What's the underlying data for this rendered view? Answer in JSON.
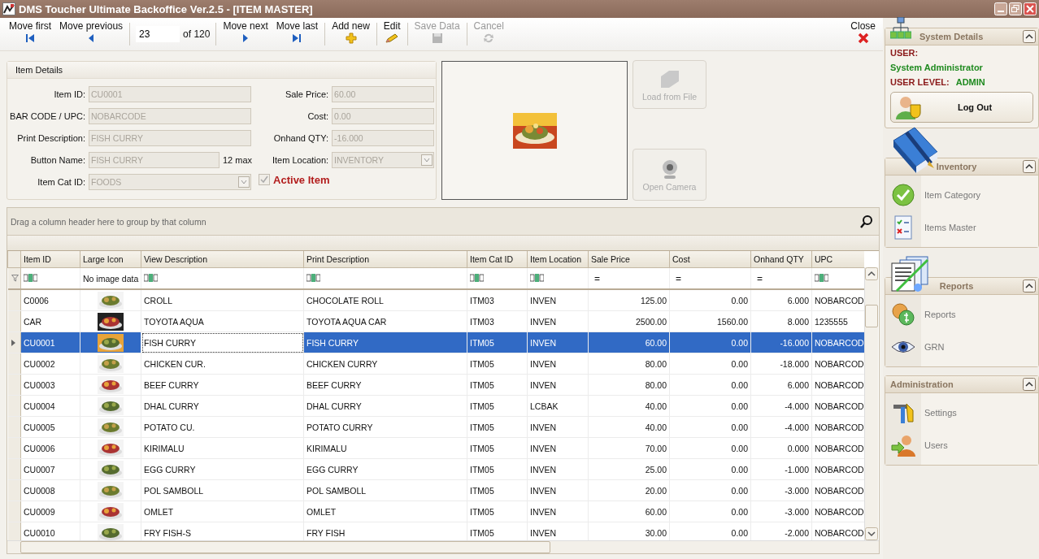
{
  "window": {
    "title": "DMS Toucher Ultimate Backoffice Ver.2.5 - [ITEM MASTER]"
  },
  "toolbar": {
    "nav": [
      {
        "label": "Move first",
        "kind": "first",
        "disabled": false
      },
      {
        "label": "Move previous",
        "kind": "previous",
        "disabled": false
      }
    ],
    "position": {
      "value": "23",
      "total": "of 120"
    },
    "actions": [
      {
        "label": "Move next",
        "kind": "next",
        "disabled": false
      },
      {
        "label": "Move last",
        "kind": "last",
        "disabled": false
      },
      {
        "label": "Add new",
        "kind": "add",
        "disabled": false
      },
      {
        "label": "Edit",
        "kind": "edit",
        "disabled": false
      },
      {
        "label": "Save Data",
        "kind": "save",
        "disabled": true
      },
      {
        "label": "Cancel",
        "kind": "cancel",
        "disabled": true
      }
    ],
    "close": {
      "label": "Close"
    }
  },
  "item_details": {
    "title": "Item Details",
    "left_fields": [
      {
        "label": "Item ID:",
        "value": "CU0001",
        "kind": "text",
        "disabled": true
      },
      {
        "label": "BAR CODE / UPC:",
        "value": "NOBARCODE",
        "kind": "text",
        "disabled": true
      },
      {
        "label": "Print Description:",
        "value": "FISH CURRY",
        "kind": "text",
        "disabled": true
      },
      {
        "label": "Button Name:",
        "value": "FISH CURRY",
        "kind": "text",
        "disabled": true,
        "note": "12 max"
      },
      {
        "label": "Item Cat ID:",
        "value": "FOODS",
        "kind": "dropdown",
        "disabled": true
      }
    ],
    "right_fields": [
      {
        "label": "Sale Price:",
        "value": "60.00",
        "kind": "text",
        "disabled": true
      },
      {
        "label": "Cost:",
        "value": "0.00",
        "kind": "text",
        "disabled": true
      },
      {
        "label": "Onhand QTY:",
        "value": "-16.000",
        "kind": "text",
        "disabled": true
      },
      {
        "label": "Item Location:",
        "value": "INVENTORY",
        "kind": "dropdown",
        "disabled": true
      }
    ],
    "active": {
      "label": "Active Item",
      "checked": true,
      "disabled": true
    }
  },
  "image_buttons": [
    {
      "label": "Load from File",
      "kind": "folder",
      "disabled": true
    },
    {
      "label": "Open Camera",
      "kind": "camera",
      "disabled": true
    }
  ],
  "grid": {
    "group_hint": "Drag a column header here to group by that column",
    "columns": [
      {
        "label": "Item ID",
        "kind": "text",
        "focused": false
      },
      {
        "label": "Large Icon",
        "kind": "icon",
        "focused": false
      },
      {
        "label": "View Description",
        "kind": "text",
        "focused": true
      },
      {
        "label": "Print Description",
        "kind": "text",
        "focused": false
      },
      {
        "label": "Item Cat ID",
        "kind": "text",
        "focused": false
      },
      {
        "label": "Item Location",
        "kind": "text",
        "focused": false
      },
      {
        "label": "Sale Price",
        "kind": "number",
        "focused": false
      },
      {
        "label": "Cost",
        "kind": "number",
        "focused": false
      },
      {
        "label": "Onhand QTY",
        "kind": "number",
        "focused": false
      },
      {
        "label": "UPC",
        "kind": "text",
        "focused": false
      }
    ],
    "filters": [
      {
        "kind": "abc"
      },
      {
        "kind": "label",
        "text": "No image data"
      },
      {
        "kind": "abc"
      },
      {
        "kind": "abc"
      },
      {
        "kind": "abc"
      },
      {
        "kind": "abc"
      },
      {
        "kind": "equals",
        "text": "="
      },
      {
        "kind": "equals",
        "text": "="
      },
      {
        "kind": "equals",
        "text": "="
      },
      {
        "kind": "abc"
      }
    ],
    "rows": [
      {
        "selected": false,
        "cells": [
          "C0006",
          "",
          "CROLL",
          "CHOCOLATE ROLL",
          "ITM03",
          "INVEN",
          "125.00",
          "0.00",
          "6.000",
          "NOBARCOD"
        ]
      },
      {
        "selected": false,
        "cells": [
          "CAR",
          "",
          "TOYOTA AQUA",
          "TOYOTA AQUA CAR",
          "ITM03",
          "INVEN",
          "2500.00",
          "1560.00",
          "8.000",
          "1235555"
        ]
      },
      {
        "selected": true,
        "cells": [
          "CU0001",
          "",
          "FISH CURRY",
          "FISH CURRY",
          "ITM05",
          "INVEN",
          "60.00",
          "0.00",
          "-16.000",
          "NOBARCOD"
        ]
      },
      {
        "selected": false,
        "cells": [
          "CU0002",
          "",
          "CHICKEN CUR.",
          "CHICKEN CURRY",
          "ITM05",
          "INVEN",
          "80.00",
          "0.00",
          "-18.000",
          "NOBARCOD"
        ]
      },
      {
        "selected": false,
        "cells": [
          "CU0003",
          "",
          "BEEF CURRY",
          "BEEF CURRY",
          "ITM05",
          "INVEN",
          "80.00",
          "0.00",
          "6.000",
          "NOBARCOD"
        ]
      },
      {
        "selected": false,
        "cells": [
          "CU0004",
          "",
          "DHAL CURRY",
          "DHAL CURRY",
          "ITM05",
          "LCBAK",
          "40.00",
          "0.00",
          "-4.000",
          "NOBARCOD"
        ]
      },
      {
        "selected": false,
        "cells": [
          "CU0005",
          "",
          "POTATO CU.",
          "POTATO CURRY",
          "ITM05",
          "INVEN",
          "40.00",
          "0.00",
          "-4.000",
          "NOBARCOD"
        ]
      },
      {
        "selected": false,
        "cells": [
          "CU0006",
          "",
          "KIRIMALU",
          "KIRIMALU",
          "ITM05",
          "INVEN",
          "70.00",
          "0.00",
          "0.000",
          "NOBARCOD"
        ]
      },
      {
        "selected": false,
        "cells": [
          "CU0007",
          "",
          "EGG CURRY",
          "EGG CURRY",
          "ITM05",
          "INVEN",
          "25.00",
          "0.00",
          "-1.000",
          "NOBARCOD"
        ]
      },
      {
        "selected": false,
        "cells": [
          "CU0008",
          "",
          "POL SAMBOLL",
          "POL SAMBOLL",
          "ITM05",
          "INVEN",
          "20.00",
          "0.00",
          "-3.000",
          "NOBARCOD"
        ]
      },
      {
        "selected": false,
        "cells": [
          "CU0009",
          "",
          "OMLET",
          "OMLET",
          "ITM05",
          "INVEN",
          "60.00",
          "0.00",
          "-3.000",
          "NOBARCOD"
        ]
      },
      {
        "selected": false,
        "cells": [
          "CU0010",
          "",
          "FRY FISH-S",
          "FRY FISH",
          "ITM05",
          "INVEN",
          "30.00",
          "0.00",
          "-2.000",
          "NOBARCOD"
        ]
      }
    ]
  },
  "sidebar": {
    "system": {
      "title": "System Details",
      "user_label": "USER:",
      "user": "System Administrator",
      "level_label": "USER LEVEL:",
      "level_value": "ADMIN",
      "logout": "Log Out"
    },
    "panels": [
      {
        "title": "Inventory",
        "kind": "book",
        "items": [
          {
            "label": "Item Category",
            "kind": "check"
          },
          {
            "label": "Items Master",
            "kind": "checklist"
          }
        ]
      },
      {
        "title": "Reports",
        "kind": "documents",
        "items": [
          {
            "label": "Reports",
            "kind": "coins"
          },
          {
            "label": "GRN",
            "kind": "eye"
          }
        ]
      },
      {
        "title": "Administration",
        "kind": "none",
        "items": [
          {
            "label": "Settings",
            "kind": "tools"
          },
          {
            "label": "Users",
            "kind": "user"
          }
        ]
      }
    ]
  }
}
